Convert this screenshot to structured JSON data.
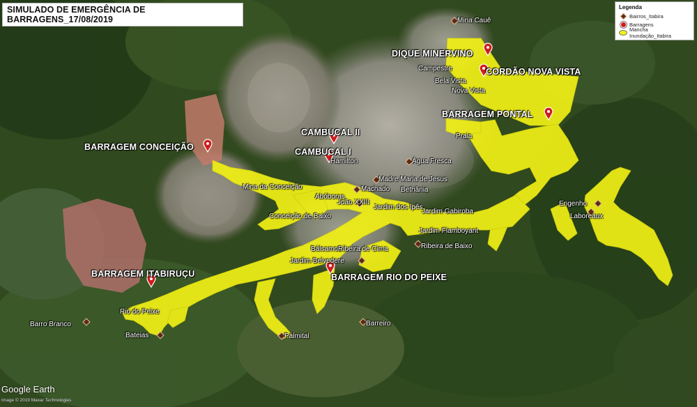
{
  "title": "SIMULADO DE EMERGÊNCIA DE BARRAGENS_17/08/2019",
  "legend": {
    "title": "Legenda",
    "items": [
      {
        "label": "Bairros_Itabira",
        "symbol": "diamond-icon",
        "color": "#5c2a12"
      },
      {
        "label": "Barragens",
        "symbol": "pin-icon",
        "color": "#d11d1d"
      },
      {
        "label": "Mancha Inundação_Itabira",
        "symbol": "ellipse-icon",
        "color": "#f2f21a"
      }
    ]
  },
  "dams": [
    {
      "id": "dique-minervino",
      "label": "DIQUE MINERVINO"
    },
    {
      "id": "cordao-nova-vista",
      "label": "CORDÃO NOVA VISTA"
    },
    {
      "id": "barragem-pontal",
      "label": "BARRAGEM  PONTAL"
    },
    {
      "id": "cambucal-ii",
      "label": "CAMBUCAL II"
    },
    {
      "id": "cambucal-i",
      "label": "CAMBUCAL I"
    },
    {
      "id": "barragem-conceicao",
      "label": "BARRAGEM CONCEIÇÃO"
    },
    {
      "id": "barragem-itabirucu",
      "label": "BARRAGEM ITABIRUÇU"
    },
    {
      "id": "barragem-rio-do-peixe",
      "label": "BARRAGEM RIO DO PEIXE"
    }
  ],
  "neighborhoods": [
    {
      "id": "mina-caue",
      "label": "Mina Cauê"
    },
    {
      "id": "campestre",
      "label": "Campestre"
    },
    {
      "id": "bela-vista",
      "label": "Bela Vista"
    },
    {
      "id": "nova-vista",
      "label": "Nova Vista"
    },
    {
      "id": "praia",
      "label": "Praia"
    },
    {
      "id": "hamilton",
      "label": "Hamilton"
    },
    {
      "id": "agua-fresca",
      "label": "Água Fresca"
    },
    {
      "id": "madre-maria-de-jesus",
      "label": "Madre Maria de Jesus"
    },
    {
      "id": "machado",
      "label": "Machado"
    },
    {
      "id": "bethania",
      "label": "Bethânia"
    },
    {
      "id": "mina-da-conceicao",
      "label": "Mina da Conceição"
    },
    {
      "id": "aboboras",
      "label": "Abóboras"
    },
    {
      "id": "joao-xxiii",
      "label": "João XXIII"
    },
    {
      "id": "jardim-dos-ipes",
      "label": "Jardim dos Ipês"
    },
    {
      "id": "jardim-gabiroba",
      "label": "Jardim Gabiroba"
    },
    {
      "id": "engenho",
      "label": "Engenho"
    },
    {
      "id": "laboreaux",
      "label": "Laboreaux"
    },
    {
      "id": "conceicao-de-baixo",
      "label": "Conceição de Baixo"
    },
    {
      "id": "jardim-flamboyant",
      "label": "Jardim Flamboyant"
    },
    {
      "id": "balsamos",
      "label": "Bálsamos"
    },
    {
      "id": "ribeira-de-cima",
      "label": "Ribeira de Cima"
    },
    {
      "id": "ribeira-de-baixo",
      "label": "Ribeira de Baixo"
    },
    {
      "id": "jardim-belvedere",
      "label": "Jardim Belvedere"
    },
    {
      "id": "rio-do-peixe",
      "label": "Rio do Peixe"
    },
    {
      "id": "barro-branco",
      "label": "Barro Branco"
    },
    {
      "id": "bateias",
      "label": "Bateias"
    },
    {
      "id": "palmital",
      "label": "Palmital"
    },
    {
      "id": "barreiro",
      "label": "Barreiro"
    }
  ],
  "attribution": {
    "logo": "Google Earth",
    "credit": "Image © 2019 Maxar Technologies"
  }
}
